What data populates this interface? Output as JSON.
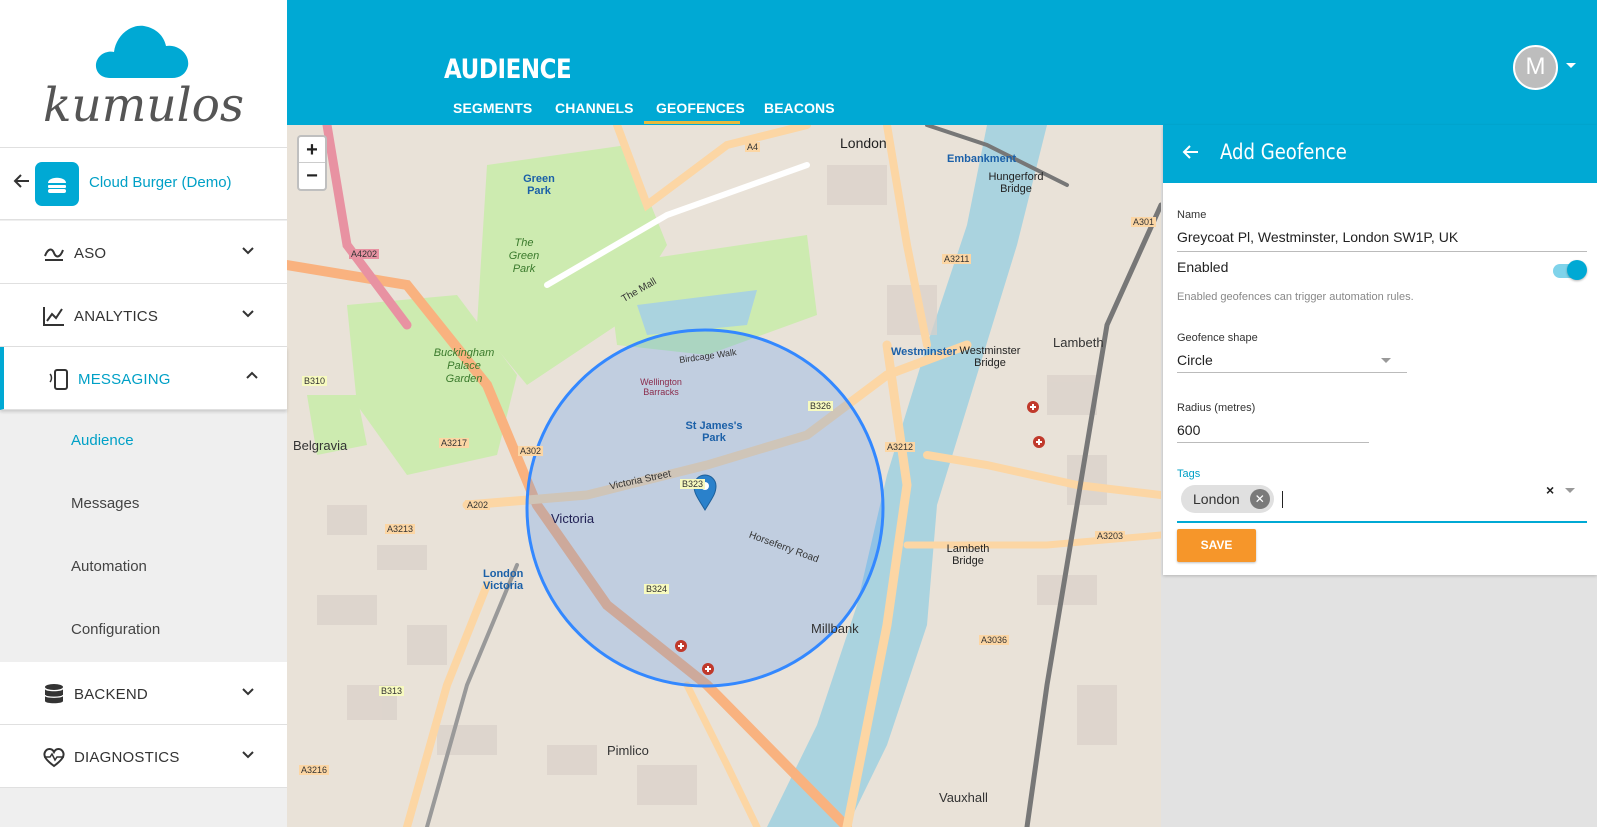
{
  "brand": {
    "logo_text": "kumulos"
  },
  "app": {
    "name": "Cloud Burger (Demo)"
  },
  "nav": {
    "aso": "ASO",
    "analytics": "ANALYTICS",
    "messaging": "MESSAGING",
    "sub": [
      "Audience",
      "Messages",
      "Automation",
      "Configuration"
    ],
    "backend": "BACKEND",
    "diagnostics": "DIAGNOSTICS"
  },
  "header": {
    "title": "AUDIENCE",
    "tabs": [
      "SEGMENTS",
      "CHANNELS",
      "GEOFENCES",
      "BEACONS"
    ],
    "active_tab": "GEOFENCES",
    "avatar_initial": "M"
  },
  "map": {
    "zoom_in": "+",
    "zoom_out": "−",
    "labels": {
      "london": "London",
      "victoria": "Victoria",
      "london_victoria": "London Victoria",
      "st_james_park": "St James's Park",
      "buckingham": "Buckingham Palace Garden",
      "green_park": "Green Park",
      "the_green_park": "The Green Park",
      "westminster": "Westminster",
      "westminster_bridge": "Westminster Bridge",
      "lambeth": "Lambeth",
      "lambeth_bridge": "Lambeth Bridge",
      "millbank": "Millbank",
      "pimlico": "Pimlico",
      "belgravia": "Belgravia",
      "vauxhall": "Vauxhall",
      "victoria_street": "Victoria Street",
      "horseferry_road": "Horseferry Road",
      "the_mall": "The Mall",
      "embankment": "Embankment",
      "hungerford": "Hungerford Bridge",
      "birdcage_walk": "Birdcage Walk",
      "wellington": "Wellington Barracks",
      "a202": "A202",
      "a3212": "A3212",
      "a3203": "A3203",
      "a3036": "A3036",
      "a3213": "A3213",
      "a3217": "A3217",
      "a4202": "A4202",
      "a4": "A4",
      "a3211": "A3211",
      "a3216": "A3216",
      "a301": "A301",
      "b310": "B310",
      "b313": "B313",
      "b323": "B323",
      "b324": "B324",
      "b326": "B326",
      "a302": "A302"
    }
  },
  "panel": {
    "title": "Add Geofence",
    "name_label": "Name",
    "name_value": "Greycoat Pl, Westminster, London SW1P, UK",
    "enabled_label": "Enabled",
    "enabled": true,
    "enabled_hint": "Enabled geofences can trigger automation rules.",
    "shape_label": "Geofence shape",
    "shape_value": "Circle",
    "radius_label": "Radius (metres)",
    "radius_value": "600",
    "tags_label": "Tags",
    "tags": [
      "London"
    ],
    "clear_label": "×",
    "save_label": "SAVE"
  },
  "colors": {
    "primary": "#00a9d4",
    "accent": "#f6962a",
    "tab_underline": "#e6b93d"
  }
}
